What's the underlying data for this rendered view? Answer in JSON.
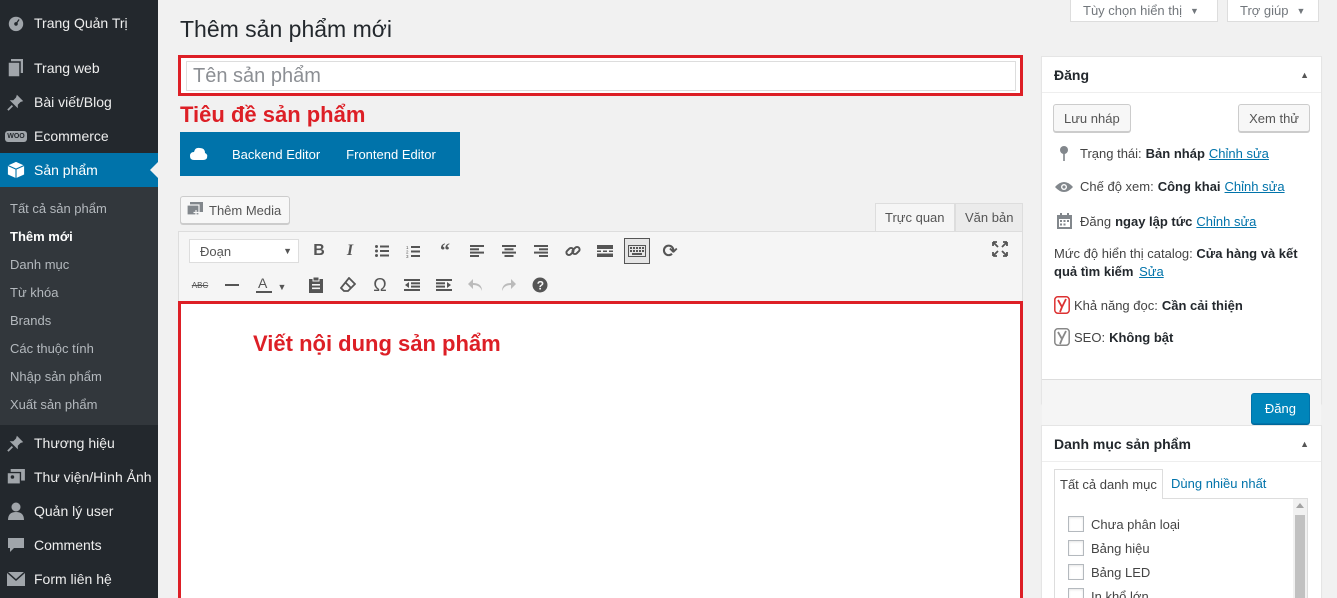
{
  "sidebar": {
    "items": [
      {
        "label": "Trang Quản Trị",
        "icon": "dashboard-icon"
      },
      {
        "label": "Trang web",
        "icon": "pages-icon"
      },
      {
        "label": "Bài viết/Blog",
        "icon": "pin-icon"
      },
      {
        "label": "Ecommerce",
        "icon": "woo-icon"
      },
      {
        "label": "Sản phẩm",
        "icon": "product-box-icon"
      },
      {
        "label": "Thương hiệu",
        "icon": "pin-icon"
      },
      {
        "label": "Thư viện/Hình Ảnh",
        "icon": "media-icon"
      },
      {
        "label": "Quản lý user",
        "icon": "user-icon"
      },
      {
        "label": "Comments",
        "icon": "comment-icon"
      },
      {
        "label": "Form liên hệ",
        "icon": "mail-icon"
      }
    ],
    "submenu": [
      "Tất cả sản phẩm",
      "Thêm mới",
      "Danh mục",
      "Từ khóa",
      "Brands",
      "Các thuộc tính",
      "Nhập sản phẩm",
      "Xuất sản phẩm"
    ],
    "woo_badge": "WOO"
  },
  "header": {
    "title": "Thêm sản phẩm mới",
    "screen_options": "Tùy chọn hiển thị",
    "help": "Trợ giúp"
  },
  "editor": {
    "title_placeholder": "Tên sản phẩm",
    "title_annotation": "Tiêu đề sản phẩm",
    "backend_editor": "Backend Editor",
    "frontend_editor": "Frontend Editor",
    "add_media": "Thêm Media",
    "tab_visual": "Trực quan",
    "tab_text": "Văn bản",
    "format_select": "Đoạn",
    "content_annotation": "Viết nội dung sản phẩm"
  },
  "publish": {
    "title": "Đăng",
    "save_draft": "Lưu nháp",
    "preview": "Xem thử",
    "status_label": "Trạng thái:",
    "status_value": "Bản nháp",
    "visibility_label": "Chế độ xem:",
    "visibility_value": "Công khai",
    "schedule_label": "Đăng",
    "schedule_value": "ngay lập tức",
    "edit_link": "Chỉnh sửa",
    "catalog_label": "Mức độ hiển thị catalog:",
    "catalog_value": "Cửa hàng và kết quả tìm kiếm",
    "catalog_edit": "Sửa",
    "readability_label": "Khả năng đọc:",
    "readability_value": "Cần cải thiện",
    "seo_label": "SEO:",
    "seo_value": "Không bật",
    "publish_button": "Đăng"
  },
  "categories": {
    "title": "Danh mục sản phẩm",
    "tab_all": "Tất cả danh mục",
    "tab_popular": "Dùng nhiều nhất",
    "items": [
      "Chưa phân loại",
      "Bảng hiệu",
      "Bảng LED",
      "In khổ lớn"
    ]
  },
  "colors": {
    "annotation_red": "#dd1f26",
    "wp_blue": "#0073aa",
    "sidebar_bg": "#23282d"
  }
}
